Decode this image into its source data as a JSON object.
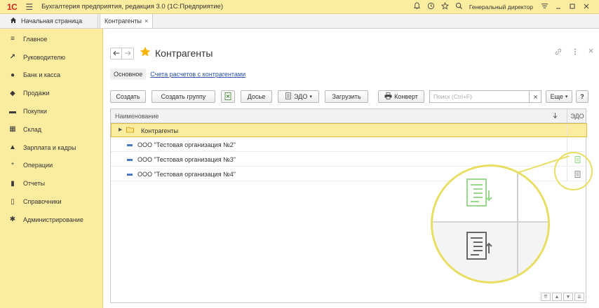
{
  "titlebar": {
    "logo": "1С",
    "menu_icon": "☰",
    "title": "Бухгалтерия предприятия, редакция 3.0  (1С:Предприятие)",
    "user": "Генеральный директор",
    "icons": [
      "bell-icon",
      "history-icon",
      "star-icon",
      "search-icon",
      "settings-icon",
      "minimize-icon",
      "maximize-icon",
      "close-icon"
    ]
  },
  "tabs": {
    "home_label": "Начальная страница",
    "current_label": "Контрагенты",
    "close_glyph": "×"
  },
  "sidebar": {
    "items": [
      {
        "label": "Главное",
        "icon": "≡"
      },
      {
        "label": "Руководителю",
        "icon": "↗"
      },
      {
        "label": "Банк и касса",
        "icon": "●"
      },
      {
        "label": "Продажи",
        "icon": "◆"
      },
      {
        "label": "Покупки",
        "icon": "▬"
      },
      {
        "label": "Склад",
        "icon": "▦"
      },
      {
        "label": "Зарплата и кадры",
        "icon": "▲"
      },
      {
        "label": "Операции",
        "icon": "⁺"
      },
      {
        "label": "Отчеты",
        "icon": "▮"
      },
      {
        "label": "Справочники",
        "icon": "▯"
      },
      {
        "label": "Администрирование",
        "icon": "✱"
      }
    ]
  },
  "form": {
    "title": "Контрагенты",
    "tabs": {
      "main": "Основное",
      "link": "Счета расчетов с контрагентами"
    },
    "toolbar": {
      "create": "Создать",
      "create_group": "Создать группу",
      "dossier": "Досье",
      "edo": "ЭДО",
      "load": "Загрузить",
      "envelope": "Конверт",
      "search_placeholder": "Поиск (Ctrl+F)",
      "more": "Еще",
      "help": "?"
    },
    "table": {
      "col_name": "Наименование",
      "col_edo": "ЭДО",
      "rows": [
        {
          "name": "Контрагенты",
          "type": "folder"
        },
        {
          "name": "ООО \"Тестовая организация №2\"",
          "type": "item"
        },
        {
          "name": "ООО \"Тестовая организация №3\"",
          "type": "item",
          "edo": "green"
        },
        {
          "name": "ООО \"Тестовая организация №4\"",
          "type": "item",
          "edo": "gray"
        }
      ]
    }
  },
  "colors": {
    "sidebar_bg": "#fbeca0",
    "accent_red": "#d2231c",
    "star": "#f5b400",
    "link": "#2a54a8",
    "edo_green": "#7ccf6c",
    "highlight": "#e8de62"
  }
}
